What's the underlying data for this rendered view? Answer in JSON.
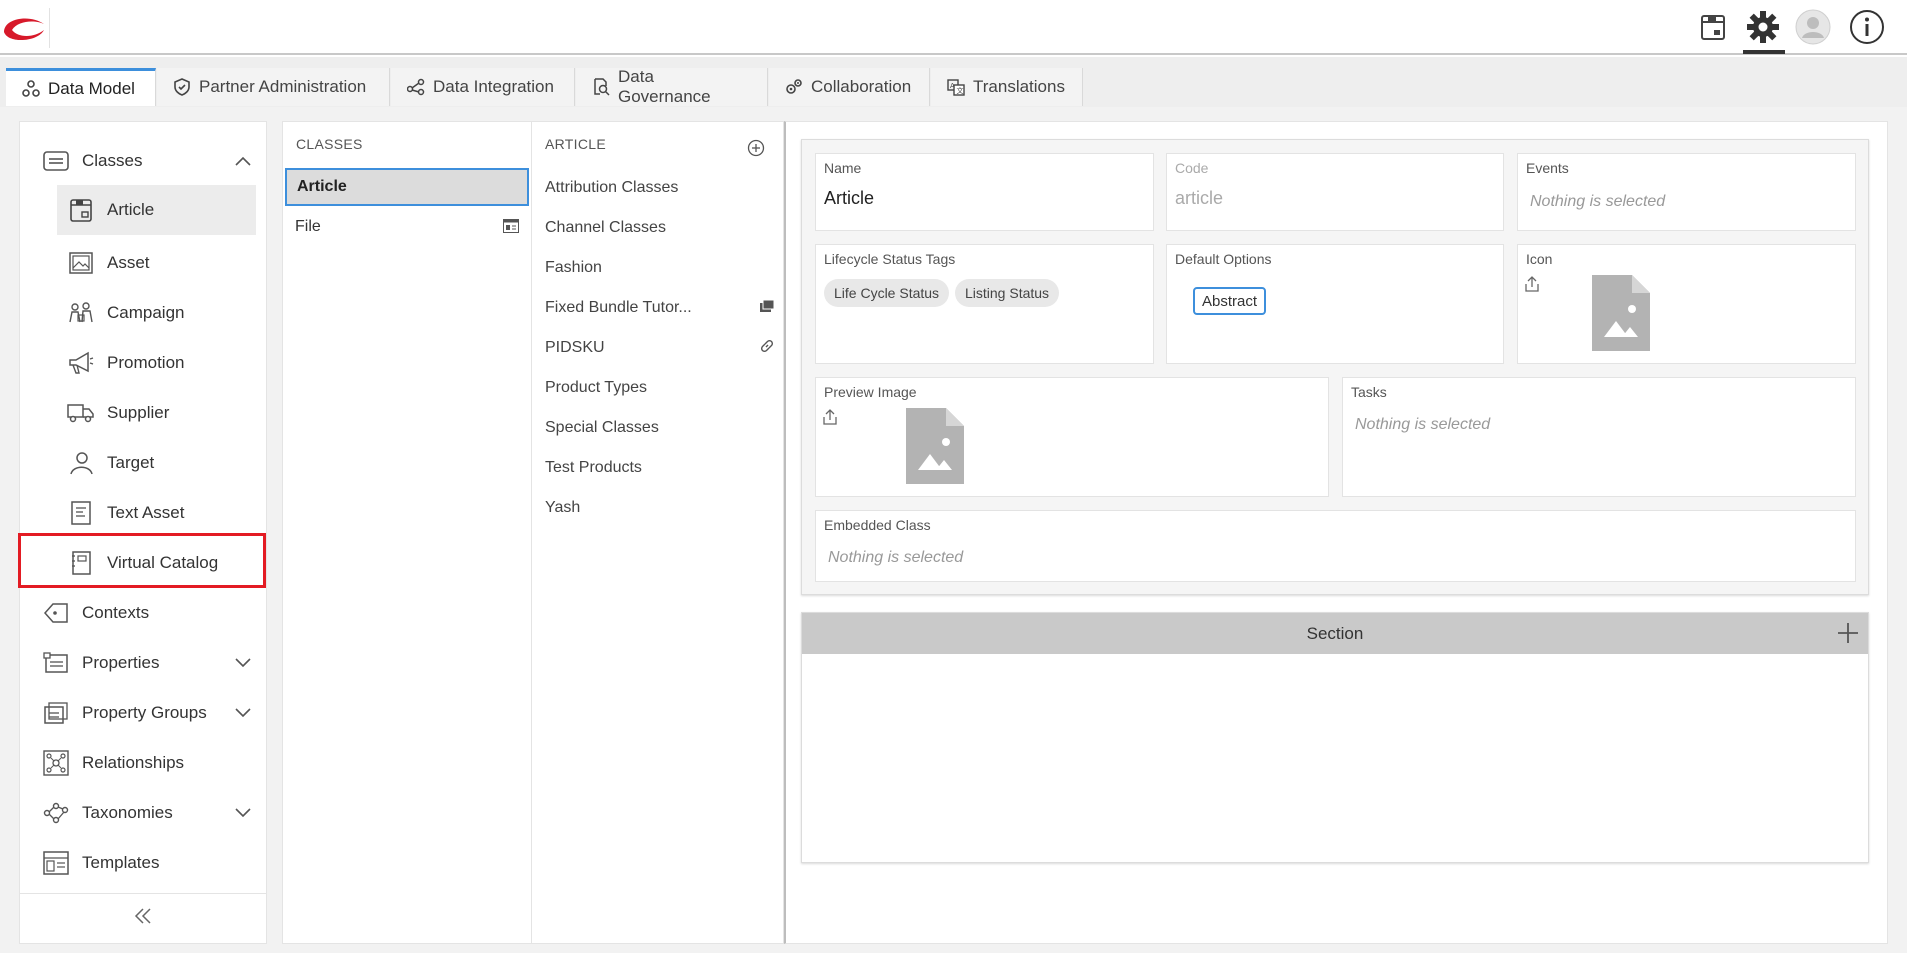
{
  "header": {
    "logo": "brand-logo",
    "icons": [
      "catalog-icon",
      "settings-gear-icon",
      "user-avatar-icon",
      "info-icon"
    ]
  },
  "tabs": [
    {
      "label": "Data Model",
      "icon": "data-model-icon",
      "active": true
    },
    {
      "label": "Partner Administration",
      "icon": "shield-icon",
      "active": false
    },
    {
      "label": "Data Integration",
      "icon": "share-nodes-icon",
      "active": false
    },
    {
      "label": "Data Governance",
      "icon": "document-search-icon",
      "active": false
    },
    {
      "label": "Collaboration",
      "icon": "gears-icon",
      "active": false
    },
    {
      "label": "Translations",
      "icon": "translate-icon",
      "active": false
    }
  ],
  "leftnav": {
    "items": [
      {
        "label": "Classes",
        "icon": "list-card-icon",
        "expanded": true
      },
      {
        "label": "Article",
        "icon": "article-box-icon",
        "selected": true
      },
      {
        "label": "Asset",
        "icon": "image-icon"
      },
      {
        "label": "Campaign",
        "icon": "campaign-icon"
      },
      {
        "label": "Promotion",
        "icon": "megaphone-icon"
      },
      {
        "label": "Supplier",
        "icon": "truck-icon"
      },
      {
        "label": "Target",
        "icon": "user-icon"
      },
      {
        "label": "Text Asset",
        "icon": "text-document-icon"
      },
      {
        "label": "Virtual Catalog",
        "icon": "catalog-book-icon",
        "highlighted": true
      },
      {
        "label": "Contexts",
        "icon": "tag-icon"
      },
      {
        "label": "Properties",
        "icon": "properties-icon",
        "expandable": true
      },
      {
        "label": "Property Groups",
        "icon": "property-groups-icon",
        "expandable": true
      },
      {
        "label": "Relationships",
        "icon": "relationships-icon"
      },
      {
        "label": "Taxonomies",
        "icon": "taxonomy-icon",
        "expandable": true
      },
      {
        "label": "Templates",
        "icon": "templates-icon"
      }
    ],
    "collapse_icon": "double-chevron-left-icon"
  },
  "classes_panel": {
    "header": "CLASSES",
    "rows": [
      {
        "label": "Article",
        "selected": true
      },
      {
        "label": "File",
        "icon": "layout-icon"
      }
    ]
  },
  "article_panel": {
    "header": "ARTICLE",
    "add_icon": "add-circle-icon",
    "rows": [
      {
        "label": "Attribution Classes"
      },
      {
        "label": "Channel Classes"
      },
      {
        "label": "Fashion"
      },
      {
        "label": "Fixed Bundle Tutor...",
        "icon": "bundle-icon"
      },
      {
        "label": "PIDSKU",
        "icon": "link-icon"
      },
      {
        "label": "Product Types"
      },
      {
        "label": "Special Classes"
      },
      {
        "label": "Test Products"
      },
      {
        "label": "Yash"
      }
    ]
  },
  "form": {
    "name": {
      "label": "Name",
      "value": "Article"
    },
    "code": {
      "label": "Code",
      "value": "article"
    },
    "events": {
      "label": "Events",
      "empty": "Nothing is selected"
    },
    "lifecycle": {
      "label": "Lifecycle Status Tags",
      "tags": [
        "Life Cycle Status",
        "Listing Status"
      ]
    },
    "default_options": {
      "label": "Default Options",
      "option": "Abstract"
    },
    "icon": {
      "label": "Icon"
    },
    "preview_image": {
      "label": "Preview Image"
    },
    "tasks": {
      "label": "Tasks",
      "empty": "Nothing is selected"
    },
    "embedded_class": {
      "label": "Embedded Class",
      "empty": "Nothing is selected"
    }
  },
  "section": {
    "title": "Section",
    "add_icon": "plus-icon"
  },
  "colors": {
    "accent": "#3d8fdc",
    "highlight": "#e31b23",
    "brand": "#d7192a"
  }
}
